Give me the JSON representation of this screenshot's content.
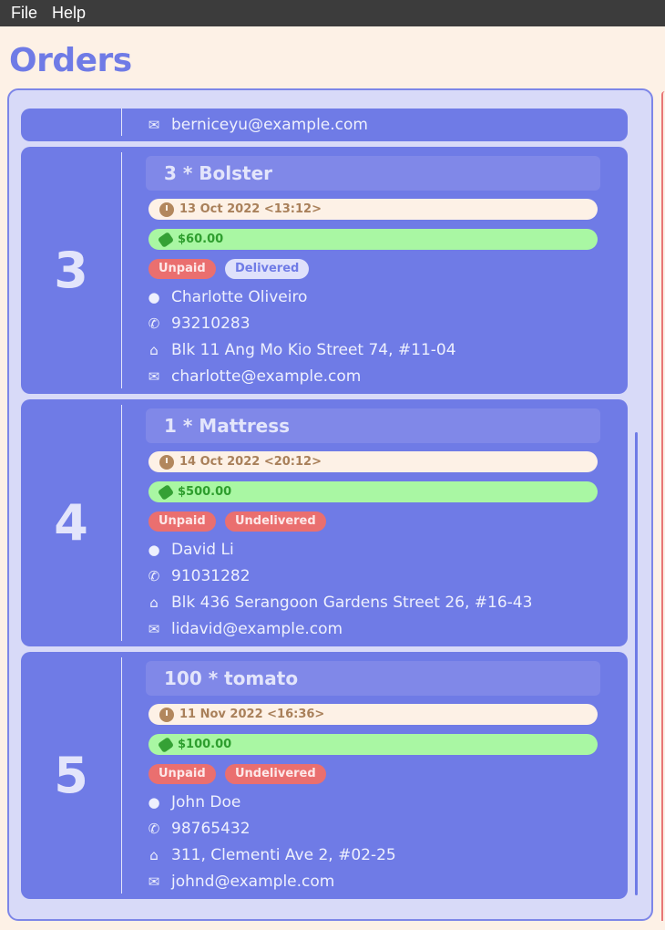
{
  "menu": {
    "file": "File",
    "help": "Help"
  },
  "page_title": "Orders",
  "top_card": {
    "email": "berniceyu@example.com"
  },
  "orders": [
    {
      "index": "3",
      "title": "3 * Bolster",
      "date": "13 Oct 2022 <13:12>",
      "price": "$60.00",
      "payment_status": "Unpaid",
      "delivery_status": "Delivered",
      "name": "Charlotte Oliveiro",
      "phone": "93210283",
      "address": "Blk 11 Ang Mo Kio Street 74, #11-04",
      "email": "charlotte@example.com"
    },
    {
      "index": "4",
      "title": "1 * Mattress",
      "date": "14 Oct 2022 <20:12>",
      "price": "$500.00",
      "payment_status": "Unpaid",
      "delivery_status": "Undelivered",
      "name": "David Li",
      "phone": "91031282",
      "address": "Blk 436 Serangoon Gardens Street 26, #16-43",
      "email": "lidavid@example.com"
    },
    {
      "index": "5",
      "title": "100 * tomato",
      "date": "11 Nov 2022 <16:36>",
      "price": "$100.00",
      "payment_status": "Unpaid",
      "delivery_status": "Undelivered",
      "name": "John Doe",
      "phone": "98765432",
      "address": "311, Clementi Ave 2, #02-25",
      "email": "johnd@example.com"
    }
  ],
  "icons": {
    "person": "person-icon",
    "phone": "phone-icon",
    "home": "home-icon",
    "email": "email-icon",
    "clock": "clock-icon",
    "tag": "price-tag-icon"
  },
  "colors": {
    "accent": "#6f7be6",
    "background": "#fdf1e6",
    "unpaid": "#ea6f6f",
    "price_pill": "#a9f7a3"
  }
}
